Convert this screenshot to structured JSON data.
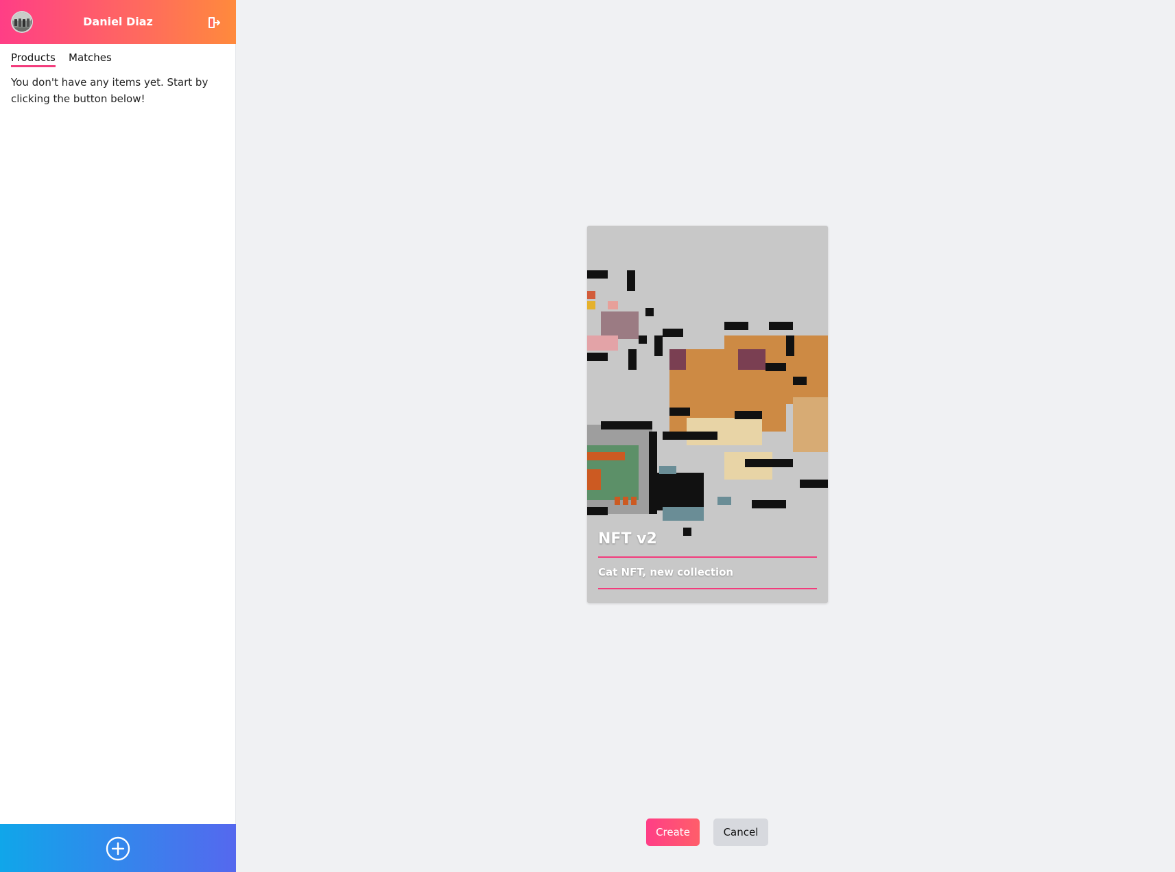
{
  "sidebar": {
    "header": {
      "user_name": "Daniel Diaz",
      "avatar_icon": "user-avatar",
      "logout_icon": "logout-icon",
      "gradient": [
        "#ff3e86",
        "#ff8a3c"
      ]
    },
    "tabs": [
      {
        "label": "Products",
        "active": true
      },
      {
        "label": "Matches",
        "active": false
      }
    ],
    "empty_message": "You don't have any items yet. Start by clicking the button below!",
    "add_button": {
      "icon": "plus-circle-icon",
      "gradient": [
        "#10a6ea",
        "#5568ee"
      ]
    }
  },
  "main": {
    "card": {
      "title": "NFT v2",
      "description": "Cat NFT, new collection",
      "image_icon": "pixel-cat-nft-image",
      "accent": "#f33b7c"
    },
    "actions": {
      "create_label": "Create",
      "cancel_label": "Cancel"
    }
  }
}
